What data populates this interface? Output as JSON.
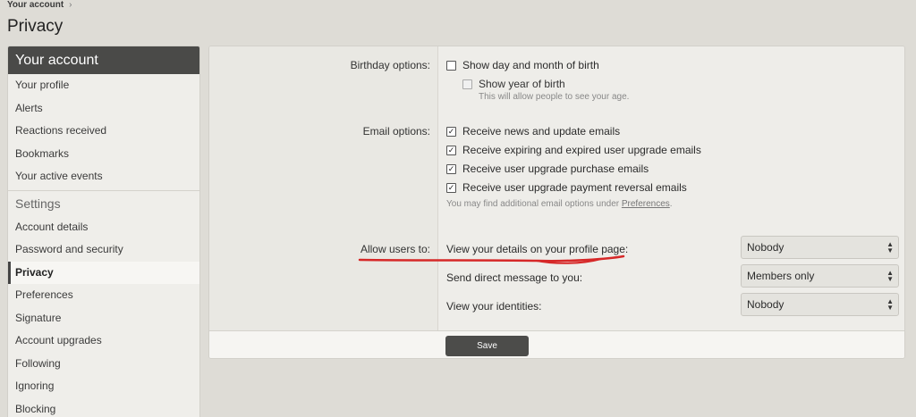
{
  "breadcrumb": {
    "item": "Your account",
    "separator": "›"
  },
  "page_title": "Privacy",
  "sidebar": {
    "header": "Your account",
    "items": [
      "Your profile",
      "Alerts",
      "Reactions received",
      "Bookmarks",
      "Your active events"
    ],
    "settings_label": "Settings",
    "settings_items": [
      "Account details",
      "Password and security",
      "Privacy",
      "Preferences",
      "Signature",
      "Account upgrades",
      "Following",
      "Ignoring",
      "Blocking"
    ],
    "active": "Privacy"
  },
  "birthday": {
    "label": "Birthday options:",
    "day_month": {
      "label": "Show day and month of birth",
      "checked": false
    },
    "year": {
      "label": "Show year of birth",
      "checked": false,
      "disabled": true
    },
    "hint": "This will allow people to see your age."
  },
  "email": {
    "label": "Email options:",
    "options": [
      {
        "label": "Receive news and update emails",
        "checked": true
      },
      {
        "label": "Receive expiring and expired user upgrade emails",
        "checked": true
      },
      {
        "label": "Receive user upgrade purchase emails",
        "checked": true
      },
      {
        "label": "Receive user upgrade payment reversal emails",
        "checked": true
      }
    ],
    "hint_prefix": "You may find additional email options under ",
    "hint_link": "Preferences",
    "hint_suffix": "."
  },
  "allow": {
    "label": "Allow users to:",
    "rows": [
      {
        "label": "View your details on your profile page:",
        "value": "Nobody"
      },
      {
        "label": "Send direct message to you:",
        "value": "Members only"
      },
      {
        "label": "View your identities:",
        "value": "Nobody"
      }
    ]
  },
  "save_label": "Save",
  "icons": {
    "checkbox_checked": "check-icon",
    "select_arrow": "updown-arrow-icon",
    "breadcrumb_chevron": "chevron-right-icon"
  },
  "colors": {
    "sidebar_header": "#4a4a48",
    "save_button": "#4c4c4a",
    "annotation": "#d62828"
  }
}
